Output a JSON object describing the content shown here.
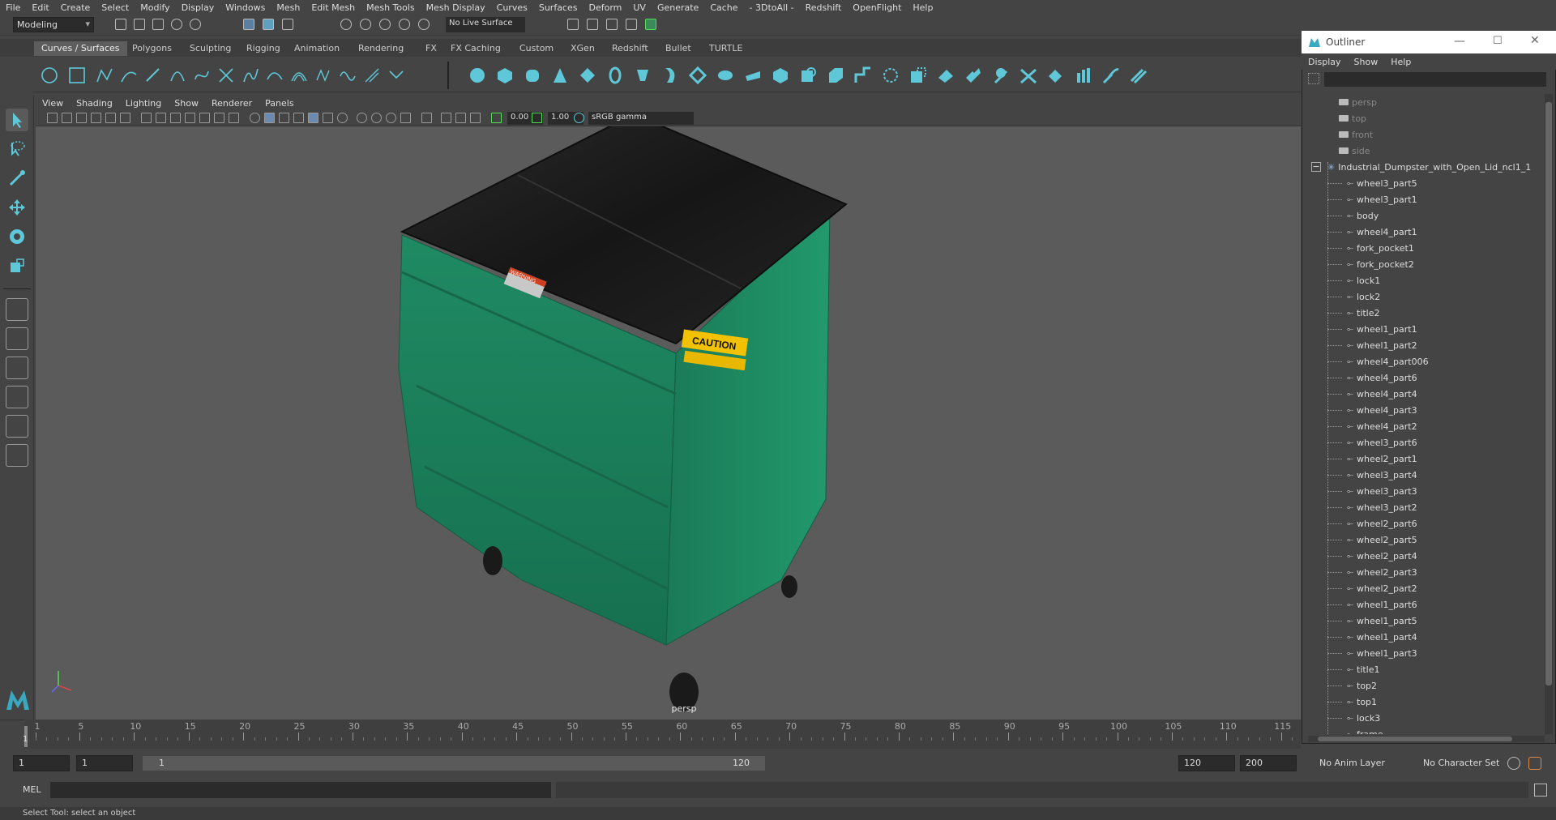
{
  "menubar": [
    "File",
    "Edit",
    "Create",
    "Select",
    "Modify",
    "Display",
    "Windows",
    "Mesh",
    "Edit Mesh",
    "Mesh Tools",
    "Mesh Display",
    "Curves",
    "Surfaces",
    "Deform",
    "UV",
    "Generate",
    "Cache",
    "- 3DtoAll -",
    "Redshift",
    "OpenFlight",
    "Help"
  ],
  "status": {
    "mode": "Modeling",
    "live_surface": "No Live Surface"
  },
  "shelf_tabs": [
    "Curves / Surfaces",
    "Polygons",
    "Sculpting",
    "Rigging",
    "Animation",
    "Rendering",
    "FX",
    "FX Caching",
    "Custom",
    "XGen",
    "Redshift",
    "Bullet",
    "TURTLE"
  ],
  "panel_menu": [
    "View",
    "Shading",
    "Lighting",
    "Show",
    "Renderer",
    "Panels"
  ],
  "panel_tools": {
    "exposure": "0.00",
    "gamma": "1.00",
    "color_space": "sRGB gamma"
  },
  "viewport": {
    "camera_label": "persp",
    "labels": {
      "warning": "WARNING",
      "caution": "CAUTION"
    }
  },
  "timeline": {
    "ticks": [
      "1",
      "5",
      "10",
      "15",
      "20",
      "25",
      "30",
      "35",
      "40",
      "45",
      "50",
      "55",
      "60",
      "65",
      "70",
      "75",
      "80",
      "85",
      "90",
      "95",
      "100",
      "105",
      "110",
      "115"
    ],
    "current_frame": "1"
  },
  "range": {
    "start": "1",
    "playback_start": "1",
    "slider_start": "1",
    "slider_end": "120",
    "playback_end": "120",
    "end": "200",
    "anim_layer": "No Anim Layer",
    "char_set": "No Character Set"
  },
  "cmd": {
    "label": "MEL"
  },
  "help_line": "Select Tool: select an object",
  "outliner": {
    "title": "Outliner",
    "menu": [
      "Display",
      "Show",
      "Help"
    ],
    "cameras": [
      "persp",
      "top",
      "front",
      "side"
    ],
    "root": "Industrial_Dumpster_with_Open_Lid_ncl1_1",
    "children": [
      "wheel3_part5",
      "wheel3_part1",
      "body",
      "wheel4_part1",
      "fork_pocket1",
      "fork_pocket2",
      "lock1",
      "lock2",
      "title2",
      "wheel1_part1",
      "wheel1_part2",
      "wheel4_part006",
      "wheel4_part6",
      "wheel4_part4",
      "wheel4_part3",
      "wheel4_part2",
      "wheel3_part6",
      "wheel2_part1",
      "wheel3_part4",
      "wheel3_part3",
      "wheel3_part2",
      "wheel2_part6",
      "wheel2_part5",
      "wheel2_part4",
      "wheel2_part3",
      "wheel2_part2",
      "wheel1_part6",
      "wheel1_part5",
      "wheel1_part4",
      "wheel1_part3",
      "title1",
      "top2",
      "top1",
      "lock3",
      "frame"
    ]
  },
  "colors": {
    "accent": "#5fc8d8",
    "dumpster": "#1f8a63",
    "lid": "#1c1c1c"
  }
}
